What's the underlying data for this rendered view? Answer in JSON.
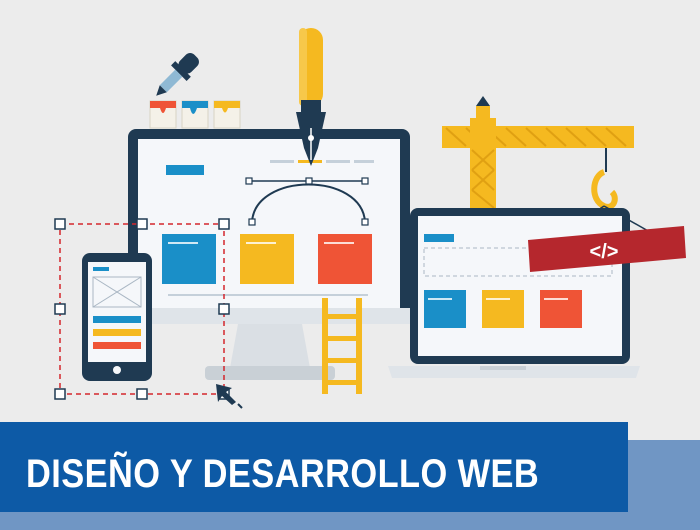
{
  "banner": {
    "title": "DISEÑO Y DESARROLLO WEB"
  },
  "code_tag": {
    "text": "</>"
  },
  "colors": {
    "background": "#ececec",
    "banner": "#0d5aa6",
    "banner_shadow": "#7096c4",
    "monitor": "#1f3a52",
    "accent_blue": "#1a8fc8",
    "accent_yellow": "#f5b920",
    "accent_red": "#ef5436",
    "crane": "#f5b920",
    "tag": "#b5272d"
  }
}
